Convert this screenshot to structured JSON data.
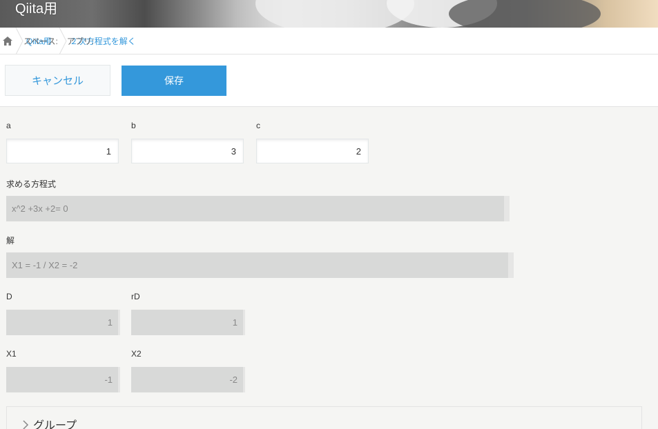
{
  "header": {
    "title": "Qiita用"
  },
  "breadcrumb": {
    "home_icon": "home-icon",
    "space_label": "スペース:",
    "space_name": "Qiita用",
    "app_label": "アプリ:",
    "app_name": "２次方程式を解く"
  },
  "toolbar": {
    "cancel_label": "キャンセル",
    "save_label": "保存"
  },
  "fields": {
    "a": {
      "label": "a",
      "value": "1"
    },
    "b": {
      "label": "b",
      "value": "3"
    },
    "c": {
      "label": "c",
      "value": "2"
    },
    "equation": {
      "label": "求める方程式",
      "value": "x^2 +3x +2= 0"
    },
    "solution": {
      "label": "解",
      "value": "X1 = -1 / X2 = -2"
    },
    "D": {
      "label": "D",
      "value": "1"
    },
    "rD": {
      "label": "rD",
      "value": "1"
    },
    "X1": {
      "label": "X1",
      "value": "-1"
    },
    "X2": {
      "label": "X2",
      "value": "-2"
    }
  },
  "group": {
    "label": "グループ",
    "icon": "chevron-right-icon"
  },
  "colors": {
    "accent": "#3498db",
    "calc_bg": "#d8d9d8",
    "page_bg": "#f5f5f3"
  }
}
